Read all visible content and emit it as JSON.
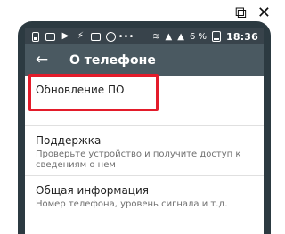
{
  "statusbar": {
    "battery_percent": "6 %",
    "time": "18:36"
  },
  "appbar": {
    "title": "О телефоне"
  },
  "list": {
    "items": [
      {
        "title": "Обновление ПО",
        "subtitle": ""
      },
      {
        "title": "Поддержка",
        "subtitle": "Проверьте устройство и получите доступ к сведениям о нем"
      },
      {
        "title": "Общая информация",
        "subtitle": "Номер телефона, уровень сигнала и т.д."
      }
    ]
  },
  "colors": {
    "statusbar": "#38434b",
    "appbar": "#4a5961",
    "highlight": "#e31b2a"
  },
  "icons": {
    "external_link": "external-link-icon",
    "close": "close-icon",
    "back": "back-arrow-icon",
    "wifi": "wifi-icon",
    "signal": "signal-icon",
    "battery": "battery-icon"
  }
}
